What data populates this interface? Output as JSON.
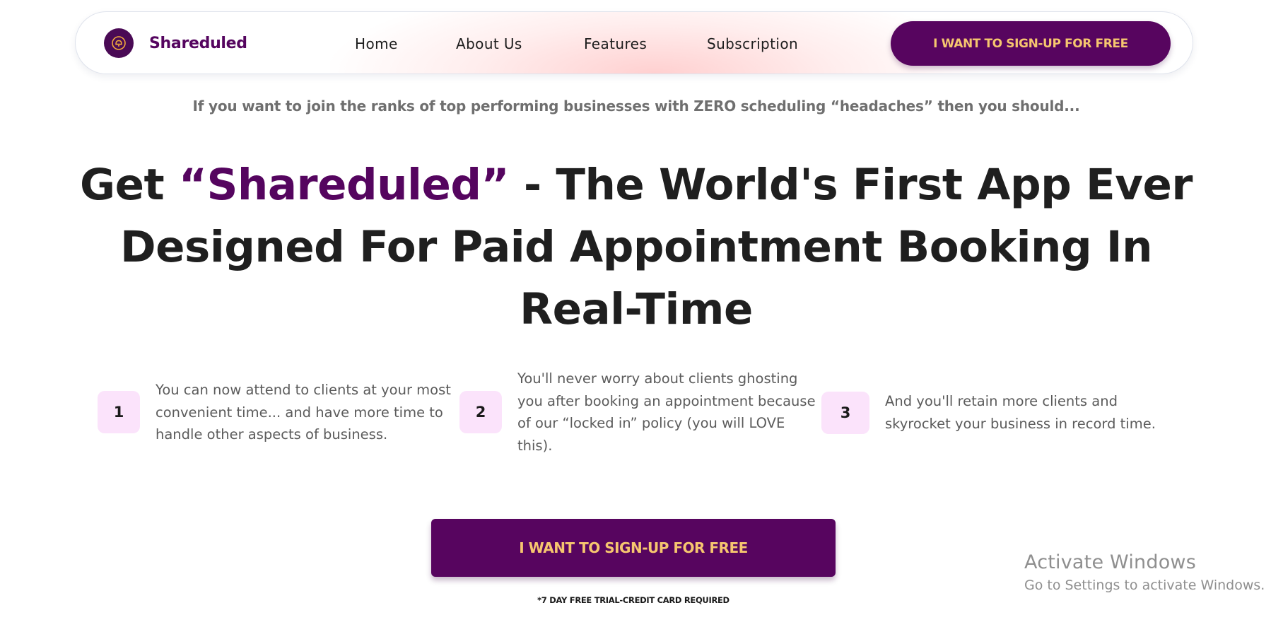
{
  "brand": {
    "name": "Shareduled",
    "logo_icon": "bell-ring-icon",
    "colors": {
      "primary": "#55055f",
      "accent_text": "#f6c66f"
    }
  },
  "nav": {
    "links": [
      {
        "label": "Home"
      },
      {
        "label": "About Us"
      },
      {
        "label": "Features"
      },
      {
        "label": "Subscription"
      }
    ],
    "cta_label": "I WANT TO SIGN-UP FOR FREE"
  },
  "hero": {
    "pre_headline": "If you want to join the ranks of top performing businesses with ZERO scheduling “headaches” then you should...",
    "headline_prefix": "Get ",
    "headline_accent": "“Shareduled”",
    "headline_suffix": " - The World's First App Ever Designed For Paid Appointment Booking In Real-Time"
  },
  "features": [
    {
      "number": "1",
      "text": "You can now attend to clients at your most convenient time... and have more time to handle other aspects of business."
    },
    {
      "number": "2",
      "text": "You'll never worry about clients ghosting you after booking an appointment because of our “locked in” policy (you will LOVE this)."
    },
    {
      "number": "3",
      "text": "And you'll retain more clients and skyrocket your business in record time."
    }
  ],
  "cta": {
    "label": "I WANT TO SIGN-UP FOR FREE",
    "note": "*7 DAY FREE TRIAL-CREDIT CARD REQUIRED"
  },
  "watermark": {
    "title": "Activate Windows",
    "subtitle": "Go to Settings to activate Windows."
  }
}
